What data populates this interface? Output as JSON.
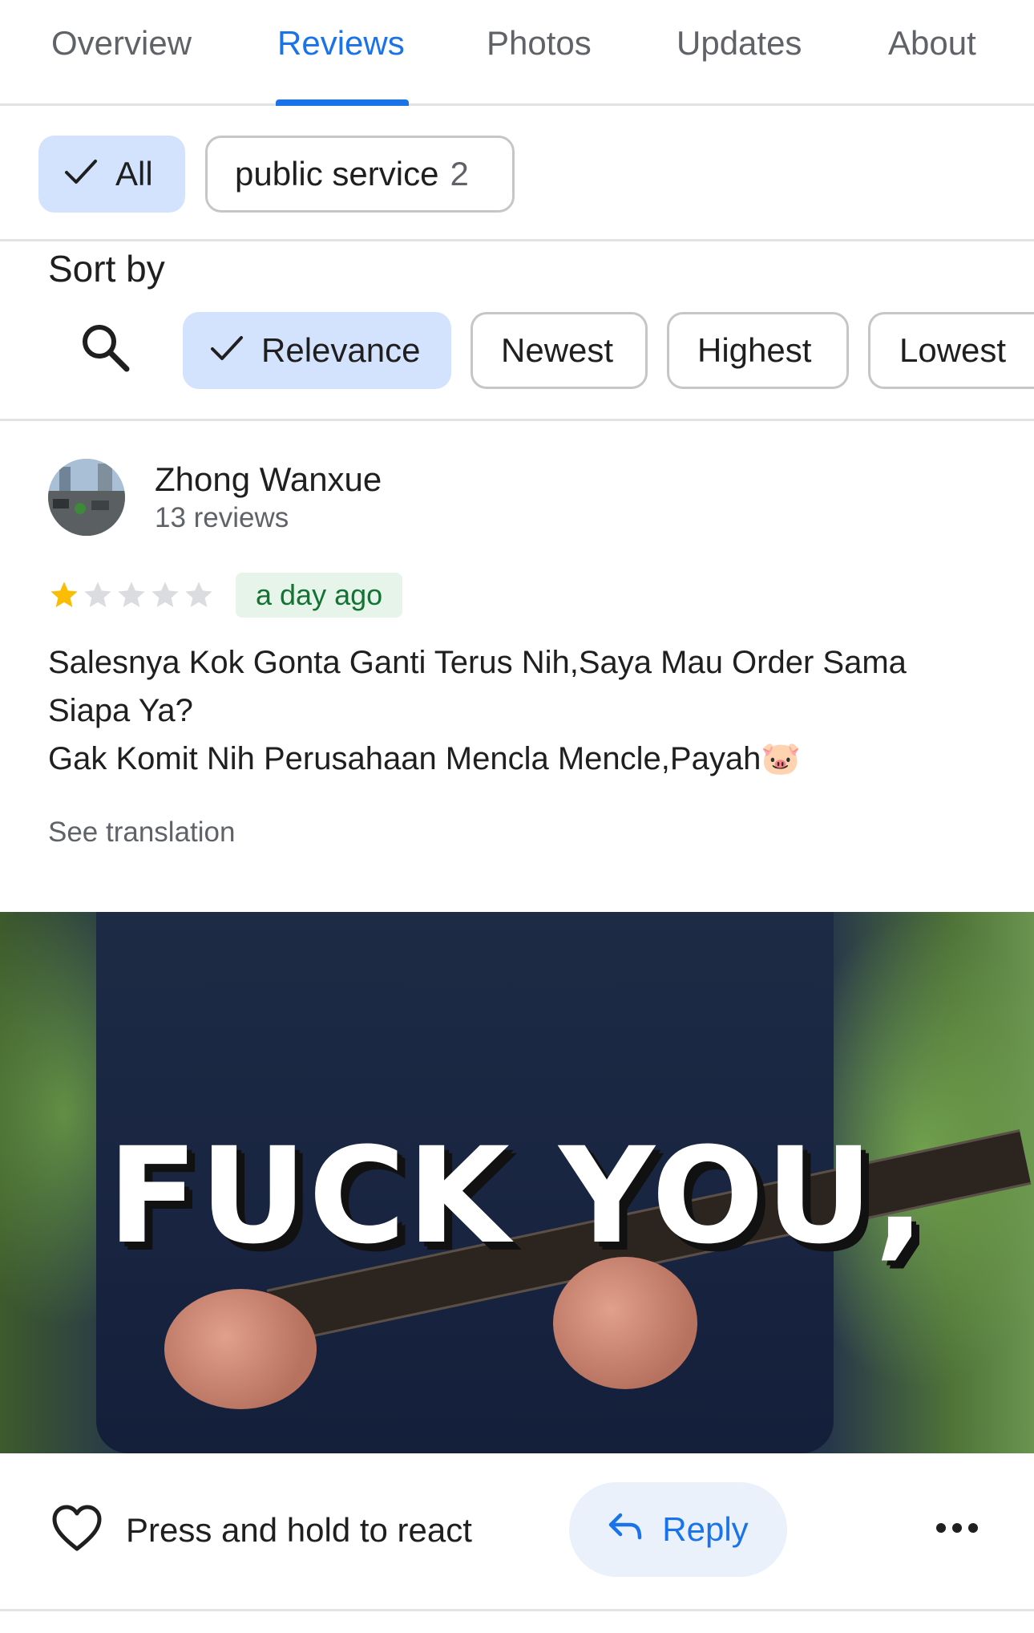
{
  "tabs": [
    {
      "label": "Overview",
      "active": false
    },
    {
      "label": "Reviews",
      "active": true
    },
    {
      "label": "Photos",
      "active": false
    },
    {
      "label": "Updates",
      "active": false
    },
    {
      "label": "About",
      "active": false
    }
  ],
  "filters": {
    "all_label": "All",
    "topic_label": "public service",
    "topic_count": "2"
  },
  "sort": {
    "label": "Sort by",
    "options": [
      "Relevance",
      "Newest",
      "Highest",
      "Lowest"
    ],
    "selected": "Relevance"
  },
  "review": {
    "author": "Zhong Wanxue",
    "author_meta": "13 reviews",
    "rating": 1,
    "rating_max": 5,
    "time": "a day ago",
    "text_lines": [
      "Salesnya Kok Gonta Ganti Terus Nih,Saya Mau Order Sama",
      "Siapa Ya?",
      "Gak Komit Nih Perusahaan Mencla Mencle,Payah🐷"
    ],
    "see_translation": "See translation",
    "media_caption": "FUCK YOU,"
  },
  "actions": {
    "react_label": "Press and hold to react",
    "reply_label": "Reply"
  },
  "icons": {
    "check": "check-icon",
    "search": "search-icon",
    "heart": "heart-outline-icon",
    "reply": "reply-arrow-icon",
    "more": "more-horizontal-icon"
  },
  "colors": {
    "accent": "#1a73e8",
    "chip_selected": "#d3e3fd",
    "star_filled": "#fbbc04",
    "star_empty": "#dadce0",
    "time_badge_bg": "#e6f4ea",
    "time_badge_text": "#137333"
  }
}
